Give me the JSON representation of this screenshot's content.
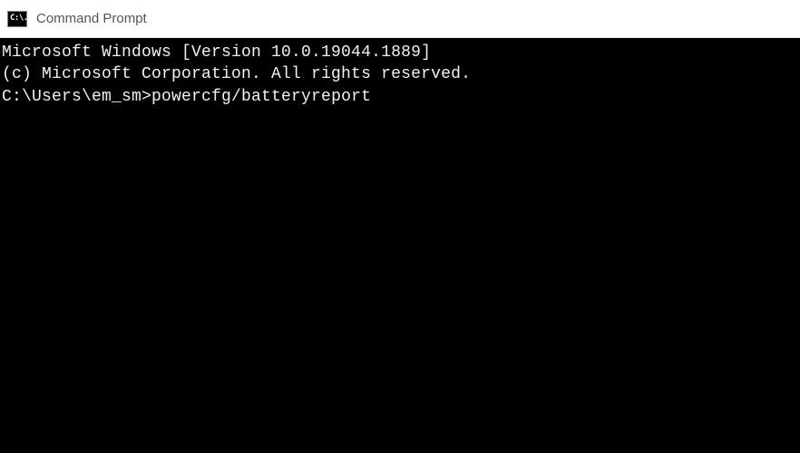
{
  "window": {
    "title": "Command Prompt",
    "icon_text": "C:\\."
  },
  "terminal": {
    "lines": [
      "Microsoft Windows [Version 10.0.19044.1889]",
      "(c) Microsoft Corporation. All rights reserved.",
      "",
      ""
    ],
    "prompt": "C:\\Users\\em_sm>",
    "command": "powercfg/batteryreport"
  }
}
